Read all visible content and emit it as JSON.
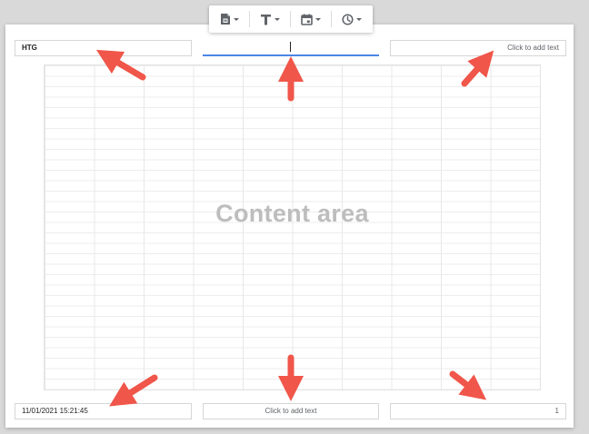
{
  "toolbar": {
    "items": [
      {
        "icon": "page-number-icon"
      },
      {
        "icon": "text-format-icon"
      },
      {
        "icon": "date-icon"
      },
      {
        "icon": "time-icon"
      }
    ]
  },
  "header": {
    "left": "HTG",
    "center": "",
    "right": "Click to add text"
  },
  "content": {
    "label": "Content area"
  },
  "footer": {
    "left": "11/01/2021 15:21:45",
    "center": "Click to add text",
    "right": "1"
  },
  "colors": {
    "arrow": "#f0564a",
    "active_underline": "#4a86e8",
    "content_label": "#bdbdbd"
  }
}
